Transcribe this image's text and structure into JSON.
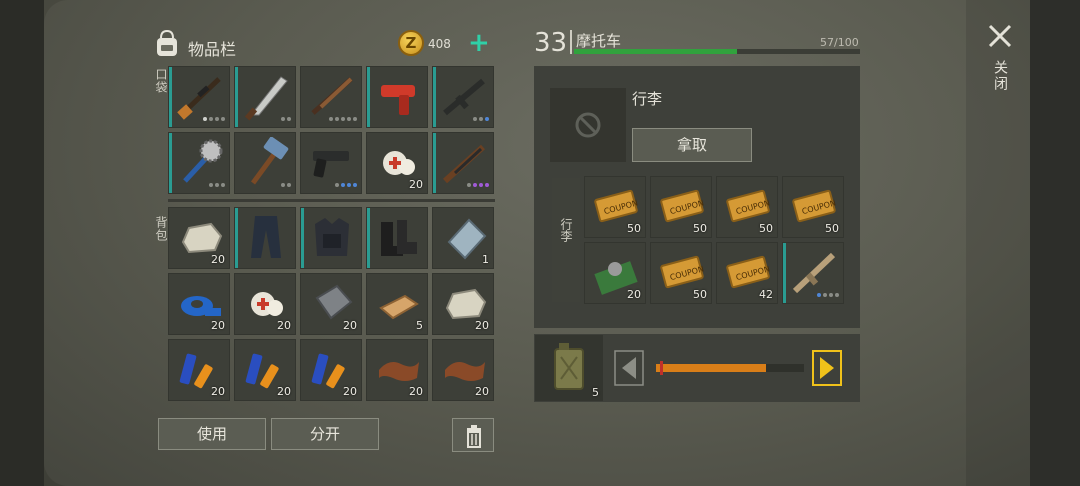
{
  "inventory": {
    "title": "物品栏",
    "coins": "408",
    "pockets_label": "口袋",
    "backpack_label": "背包",
    "pockets": [
      {
        "icon": "rifle-scoped-icon",
        "dots": [
          1,
          0,
          0,
          0
        ]
      },
      {
        "icon": "machete-icon",
        "dots": [
          0,
          0
        ]
      },
      {
        "icon": "shotgun-icon",
        "dots": [
          0,
          0,
          0,
          0,
          0
        ]
      },
      {
        "icon": "flare-gun-icon",
        "dots": []
      },
      {
        "icon": "assault-rifle-icon",
        "dots": [
          0,
          0,
          2
        ]
      },
      {
        "icon": "spiked-club-icon",
        "dots": [
          0,
          0,
          0
        ]
      },
      {
        "icon": "sledgehammer-icon",
        "dots": [
          0,
          0
        ]
      },
      {
        "icon": "pistol-icon",
        "dots": [
          0,
          2,
          2,
          2
        ]
      },
      {
        "icon": "bandage-icon",
        "qty": "20"
      },
      {
        "icon": "ak-rifle-icon",
        "dots": [
          0,
          3,
          3,
          3
        ]
      }
    ],
    "backpack": [
      {
        "icon": "stone-icon",
        "qty": "20"
      },
      {
        "icon": "tactical-pants-icon"
      },
      {
        "icon": "tactical-vest-icon"
      },
      {
        "icon": "boots-icon"
      },
      {
        "icon": "glass-sheet-icon",
        "qty": "1"
      },
      {
        "icon": "duct-tape-icon",
        "qty": "20"
      },
      {
        "icon": "bandage-icon",
        "qty": "20"
      },
      {
        "icon": "iron-plate-icon",
        "qty": "20"
      },
      {
        "icon": "wood-plank-icon",
        "qty": "5"
      },
      {
        "icon": "stone-icon",
        "qty": "20"
      },
      {
        "icon": "batteries-icon",
        "qty": "20"
      },
      {
        "icon": "batteries-icon",
        "qty": "20"
      },
      {
        "icon": "batteries-icon",
        "qty": "20"
      },
      {
        "icon": "leather-icon",
        "qty": "20"
      },
      {
        "icon": "leather-icon",
        "qty": "20"
      }
    ],
    "use_label": "使用",
    "split_label": "分开"
  },
  "vehicle": {
    "level": "33",
    "name": "摩托车",
    "capacity": "57/100",
    "capacity_fraction": 0.57,
    "loot_label": "行李",
    "take_label": "拿取",
    "cargo_label": "行李",
    "cargo": [
      {
        "icon": "coupon-icon",
        "qty": "50"
      },
      {
        "icon": "coupon-icon",
        "qty": "50"
      },
      {
        "icon": "coupon-icon",
        "qty": "50"
      },
      {
        "icon": "coupon-icon",
        "qty": "50"
      },
      {
        "icon": "circuit-board-icon",
        "qty": "20"
      },
      {
        "icon": "coupon-icon",
        "qty": "50"
      },
      {
        "icon": "coupon-icon",
        "qty": "42"
      },
      {
        "icon": "scar-rifle-icon",
        "dots": [
          2,
          0,
          0,
          0
        ]
      }
    ],
    "fuel_qty": "5",
    "fuel_fraction": 0.74
  },
  "close_label": "关闭",
  "colors": {
    "accent": "#2a9c92",
    "capacity": "#31a23d",
    "fuel": "#d97e18",
    "arrow": "#f0c21a"
  }
}
